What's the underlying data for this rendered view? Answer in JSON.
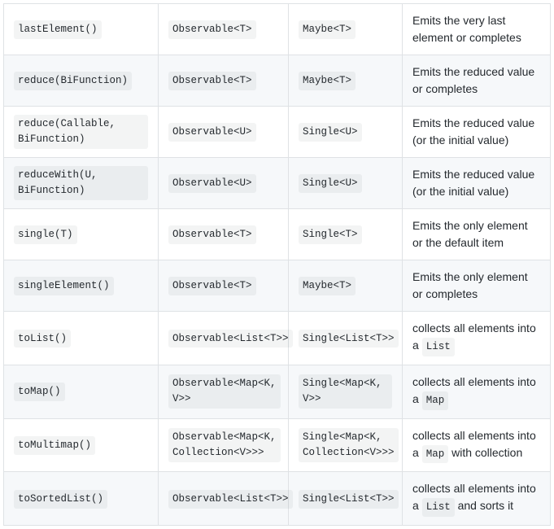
{
  "rows": [
    {
      "operator": "lastElement()",
      "source": "Observable<T>",
      "result": "Maybe<T>",
      "desc_pre": "Emits the very last element or completes",
      "desc_code": "",
      "desc_post": ""
    },
    {
      "operator": "reduce(BiFunction)",
      "source": "Observable<T>",
      "result": "Maybe<T>",
      "desc_pre": "Emits the reduced value or completes",
      "desc_code": "",
      "desc_post": ""
    },
    {
      "operator": "reduce(Callable, BiFunction)",
      "source": "Observable<U>",
      "result": "Single<U>",
      "desc_pre": "Emits the reduced value (or the initial value)",
      "desc_code": "",
      "desc_post": ""
    },
    {
      "operator": "reduceWith(U, BiFunction)",
      "source": "Observable<U>",
      "result": "Single<U>",
      "desc_pre": "Emits the reduced value (or the initial value)",
      "desc_code": "",
      "desc_post": ""
    },
    {
      "operator": "single(T)",
      "source": "Observable<T>",
      "result": "Single<T>",
      "desc_pre": "Emits the only element or the default item",
      "desc_code": "",
      "desc_post": ""
    },
    {
      "operator": "singleElement()",
      "source": "Observable<T>",
      "result": "Maybe<T>",
      "desc_pre": "Emits the only element or completes",
      "desc_code": "",
      "desc_post": ""
    },
    {
      "operator": "toList()",
      "source": "Observable<List<T>>",
      "result": "Single<List<T>>",
      "desc_pre": "collects all elements into a ",
      "desc_code": "List",
      "desc_post": ""
    },
    {
      "operator": "toMap()",
      "source": "Observable<Map<K, V>>",
      "result": "Single<Map<K, V>>",
      "desc_pre": "collects all elements into a ",
      "desc_code": "Map",
      "desc_post": ""
    },
    {
      "operator": "toMultimap()",
      "source": "Observable<Map<K, Collection<V>>>",
      "result": "Single<Map<K, Collection<V>>>",
      "desc_pre": "collects all elements into a ",
      "desc_code": "Map",
      "desc_post": " with collection"
    },
    {
      "operator": "toSortedList()",
      "source": "Observable<List<T>>",
      "result": "Single<List<T>>",
      "desc_pre": "collects all elements into a ",
      "desc_code": "List",
      "desc_post": " and sorts it"
    }
  ]
}
